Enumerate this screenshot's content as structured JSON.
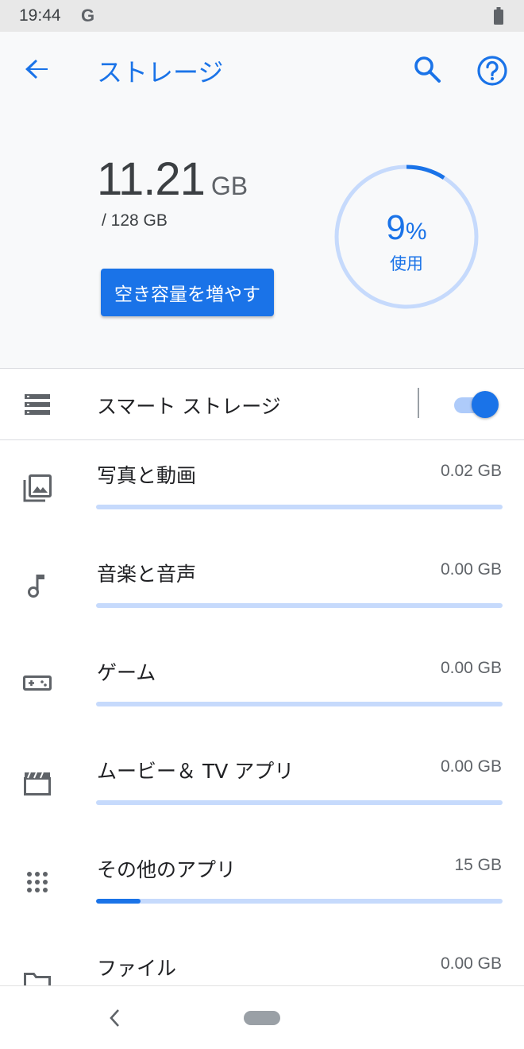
{
  "status_bar": {
    "time": "19:44",
    "g_label": "G"
  },
  "app_bar": {
    "title": "ストレージ"
  },
  "summary": {
    "used_value": "11.21",
    "used_unit": "GB",
    "total": "/ 128 GB",
    "free_up_button": "空き容量を増やす",
    "percent_value": "9",
    "percent_sign": "%",
    "percent_label": "使用",
    "usage_fraction": 0.09
  },
  "smart_storage": {
    "label": "スマート ストレージ",
    "enabled": true
  },
  "categories": [
    {
      "label": "写真と動画",
      "size": "0.02 GB",
      "fraction": 0.0,
      "icon": "photo-library-icon"
    },
    {
      "label": "音楽と音声",
      "size": "0.00 GB",
      "fraction": 0.0,
      "icon": "music-note-icon"
    },
    {
      "label": "ゲーム",
      "size": "0.00 GB",
      "fraction": 0.0,
      "icon": "gamepad-icon"
    },
    {
      "label": "ムービー＆ TV アプリ",
      "size": "0.00 GB",
      "fraction": 0.0,
      "icon": "movie-icon"
    },
    {
      "label": "その他のアプリ",
      "size": "15 GB",
      "fraction": 0.11,
      "icon": "apps-grid-icon"
    },
    {
      "label": "ファイル",
      "size": "0.00 GB",
      "fraction": 0.0,
      "icon": "folder-icon"
    }
  ],
  "colors": {
    "accent": "#1a73e8",
    "accent_light": "#c6dafc",
    "background_top": "#f8f9fa"
  }
}
